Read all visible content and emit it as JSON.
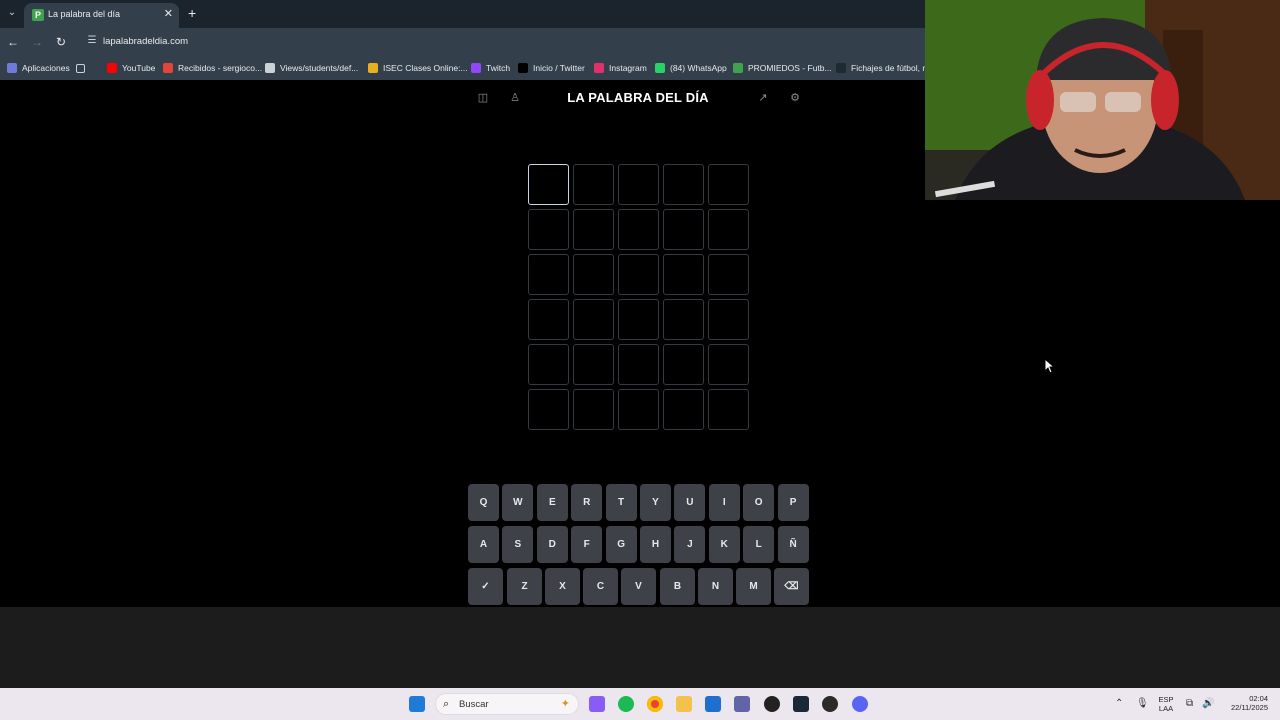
{
  "browser": {
    "tab": {
      "favicon_letter": "P",
      "title": "La palabra del día",
      "close": "✕"
    },
    "new_tab": "+",
    "url": "lapalabradeldia.com",
    "bookmarks": [
      {
        "label": "Aplicaciones",
        "color": "#6f7bd8"
      },
      {
        "label": "YouTube",
        "color": "#ff0000"
      },
      {
        "label": "Recibidos - sergioco...",
        "color": "#e0463a"
      },
      {
        "label": "Views/students/def...",
        "color": "#c9d1d9"
      },
      {
        "label": "ISEC Clases Online:...",
        "color": "#e8b020"
      },
      {
        "label": "Twitch",
        "color": "#9146ff"
      },
      {
        "label": "Inicio / Twitter",
        "color": "#000000"
      },
      {
        "label": "Instagram",
        "color": "#e1306c"
      },
      {
        "label": "(84) WhatsApp",
        "color": "#25d366"
      },
      {
        "label": "PROMIEDOS - Futb...",
        "color": "#3fa34d"
      },
      {
        "label": "Fichajes de fútbol, r...",
        "color": "#1f2932"
      }
    ]
  },
  "game": {
    "title": "LA PALABRA DEL DÍA",
    "rows": 6,
    "cols": 5,
    "active_cell": [
      0,
      0
    ],
    "keyboard": {
      "row1": [
        "Q",
        "W",
        "E",
        "R",
        "T",
        "Y",
        "U",
        "I",
        "O",
        "P"
      ],
      "row2": [
        "A",
        "S",
        "D",
        "F",
        "G",
        "H",
        "J",
        "K",
        "L",
        "Ñ"
      ],
      "row3": [
        "✓",
        "Z",
        "X",
        "C",
        "V",
        "B",
        "N",
        "M",
        "⌫"
      ]
    }
  },
  "taskbar": {
    "search_placeholder": "Buscar",
    "lang_top": "ESP",
    "lang_bottom": "LAA",
    "time": "02:04",
    "date": "22/11/2025"
  },
  "colors": {
    "accent_tab": "#33404b",
    "key_bg": "#3e4148",
    "cell_border": "#353a41",
    "active_border": "#c8d3e4"
  }
}
